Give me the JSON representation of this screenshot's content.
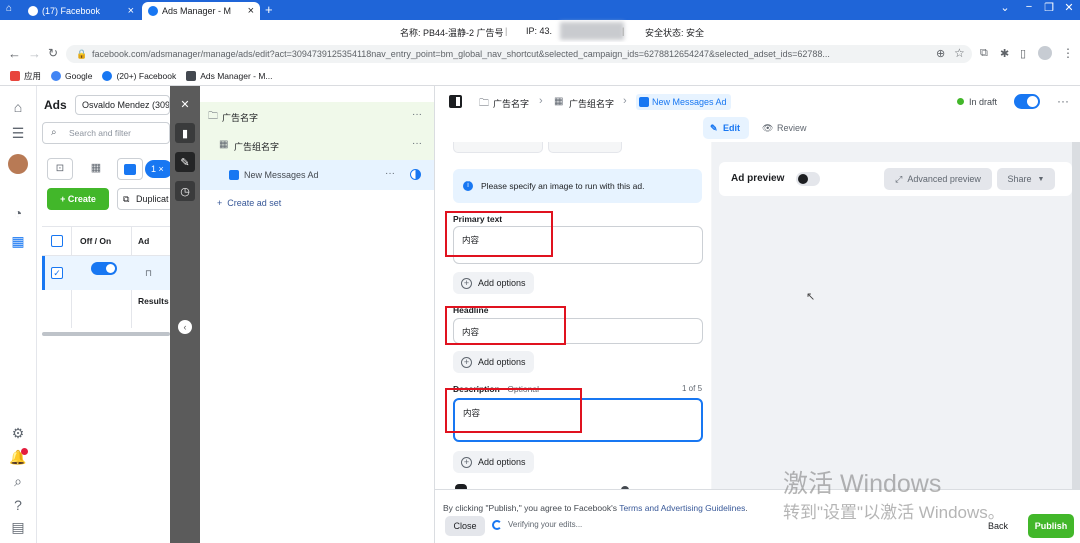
{
  "browser": {
    "tabs": [
      {
        "label": "(17) Facebook",
        "close": "×"
      },
      {
        "label": "Ads Manager - M",
        "close": "×"
      }
    ],
    "new_tab": "+",
    "ip_bar": {
      "name": "名称: PB44-温静-2 广告号",
      "ip": "IP: 43.",
      "security": "安全状态: 安全"
    },
    "url": "facebook.com/adsmanager/manage/ads/edit?act=3094739125354118nav_entry_point=bm_global_nav_shortcut&selected_campaign_ids=6278812654247&selected_adset_ids=62788...",
    "bookmarks": [
      {
        "label": "应用",
        "color": "#e8453c"
      },
      {
        "label": "Google",
        "color": "#4285f4"
      },
      {
        "label": "(20+) Facebook",
        "color": "#1877f2"
      },
      {
        "label": "Ads Manager - M...",
        "color": "#444950"
      }
    ]
  },
  "ads_panel": {
    "title": "Ads",
    "account": "Osvaldo Mendez (309",
    "search_placeholder": "Search and filter",
    "selected_count": "1 ×",
    "create": "Create",
    "duplicate": "Duplicat",
    "col_offon": "Off / On",
    "col_ad": "Ad",
    "results": "Results"
  },
  "tree": {
    "campaign": "广告名字",
    "adset": "广告组名字",
    "ad": "New Messages Ad",
    "create_adset": "Create ad set"
  },
  "topbar": {
    "crumb_campaign": "广告名字",
    "crumb_adset": "广告组名字",
    "crumb_ad": "New Messages Ad",
    "status": "In draft"
  },
  "tabs": {
    "edit": "Edit",
    "review": "Review"
  },
  "editor": {
    "info": "Please specify an image to run with this ad.",
    "primary_text_label": "Primary text",
    "primary_text_value": "内容",
    "add_options": "Add options",
    "headline_label": "Headline",
    "headline_value": "内容",
    "description_label": "Description",
    "description_optional": " · Optional",
    "description_count": "1 of 5",
    "description_value": "内容"
  },
  "preview": {
    "title": "Ad preview",
    "advanced": "Advanced preview",
    "share": "Share"
  },
  "bottom": {
    "terms_prefix": "By clicking \"Publish,\" you agree to Facebook's ",
    "terms_link": "Terms and Advertising Guidelines",
    "terms_suffix": ".",
    "close": "Close",
    "verifying": "Verifying your edits...",
    "back": "Back",
    "publish": "Publish"
  },
  "watermark": {
    "line1": "激活 Windows",
    "line2": "转到\"设置\"以激活 Windows。"
  },
  "colors": {
    "fb_blue": "#1877f2",
    "chrome_blue": "#1f65d8",
    "green": "#42b72a",
    "red_annotation": "#e0121f"
  }
}
